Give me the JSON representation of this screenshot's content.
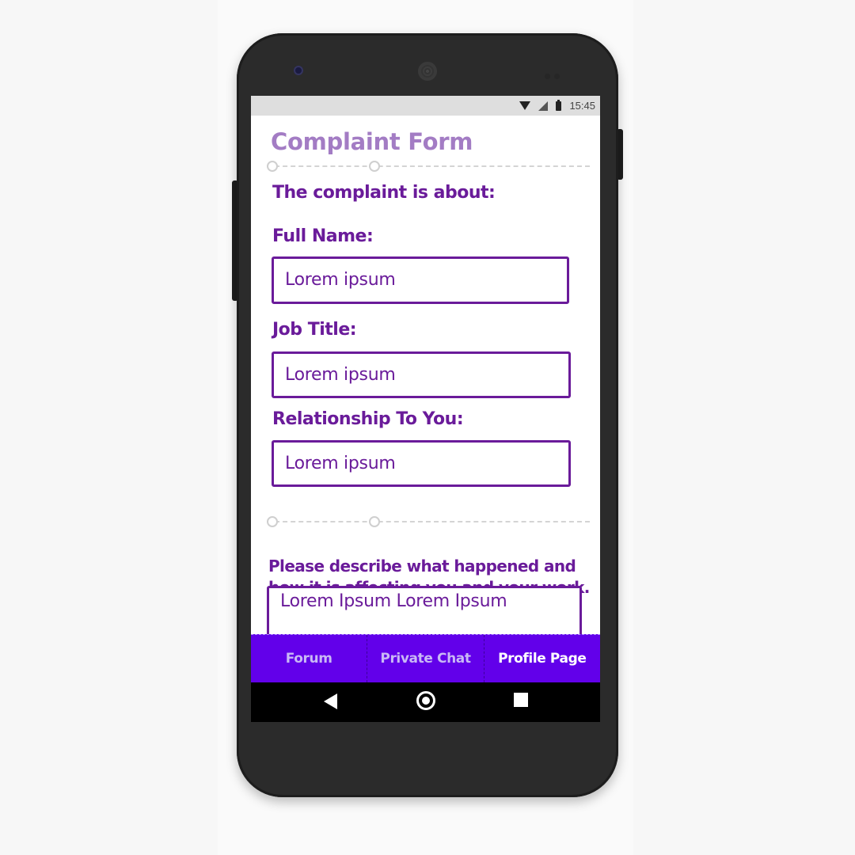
{
  "status_bar": {
    "time": "15:45",
    "icons": [
      "wifi-icon",
      "signal-icon",
      "battery-icon"
    ]
  },
  "form": {
    "title": "Complaint Form",
    "about_label": "The complaint is about:",
    "full_name": {
      "label": "Full Name:",
      "value": "Lorem ipsum"
    },
    "job_title": {
      "label": "Job Title:",
      "value": "Lorem ipsum"
    },
    "relationship": {
      "label": "Relationship To You:",
      "value": "Lorem ipsum"
    },
    "description": {
      "label": "Please describe what happened and how it is affecting you and your work.",
      "value": "Lorem Ipsum Lorem Ipsum"
    }
  },
  "tabs": [
    {
      "label": "Forum"
    },
    {
      "label": "Private Chat"
    },
    {
      "label": "Profile Page"
    }
  ],
  "colors": {
    "title": "#a37cc4",
    "accent": "#6a1b9a",
    "tab_bar": "#6200ea",
    "active_tab_text": "#ffffff"
  },
  "nav_bar": {
    "icons": [
      "back-icon",
      "home-icon",
      "recent-apps-icon"
    ]
  }
}
